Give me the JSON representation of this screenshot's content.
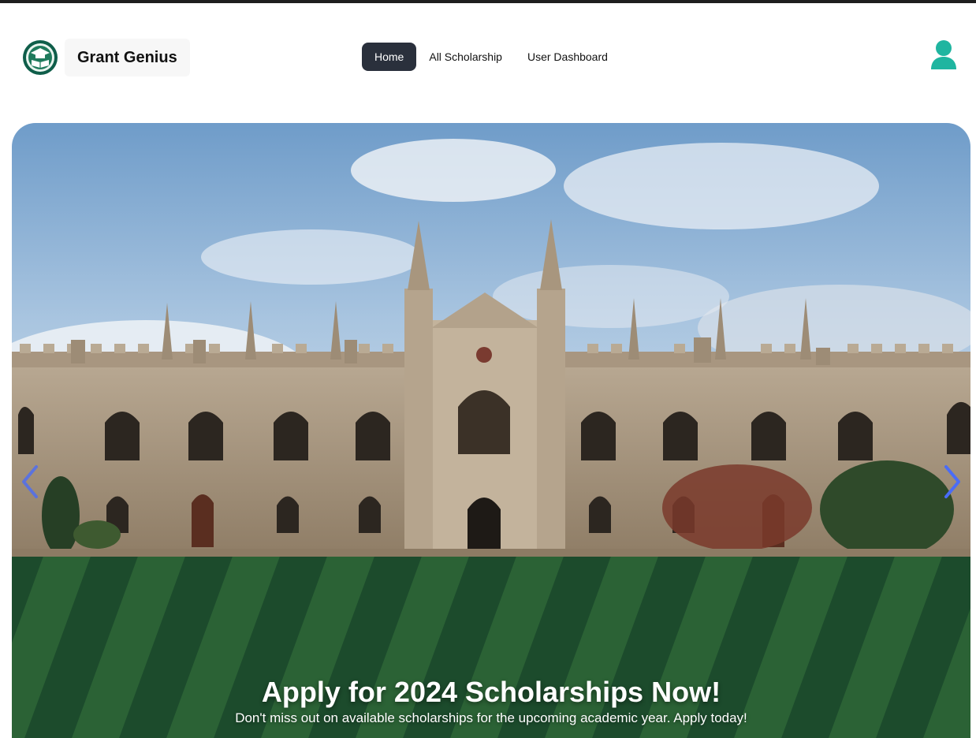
{
  "brand": {
    "name": "Grant Genius",
    "logo_icon": "graduation-book-icon"
  },
  "nav": {
    "items": [
      {
        "label": "Home",
        "active": true
      },
      {
        "label": "All Scholarship",
        "active": false
      },
      {
        "label": "User Dashboard",
        "active": false
      }
    ]
  },
  "user": {
    "icon": "user-icon",
    "color": "#1fb5a0"
  },
  "hero": {
    "title": "Apply for 2024 Scholarships Now!",
    "subtitle": "Don't miss out on available scholarships for the upcoming academic year. Apply today!",
    "prev_icon": "chevron-left-icon",
    "next_icon": "chevron-right-icon",
    "arrow_color": "#4a6cf7"
  },
  "colors": {
    "nav_active_bg": "#2a303c",
    "accent": "#1fb5a0"
  }
}
